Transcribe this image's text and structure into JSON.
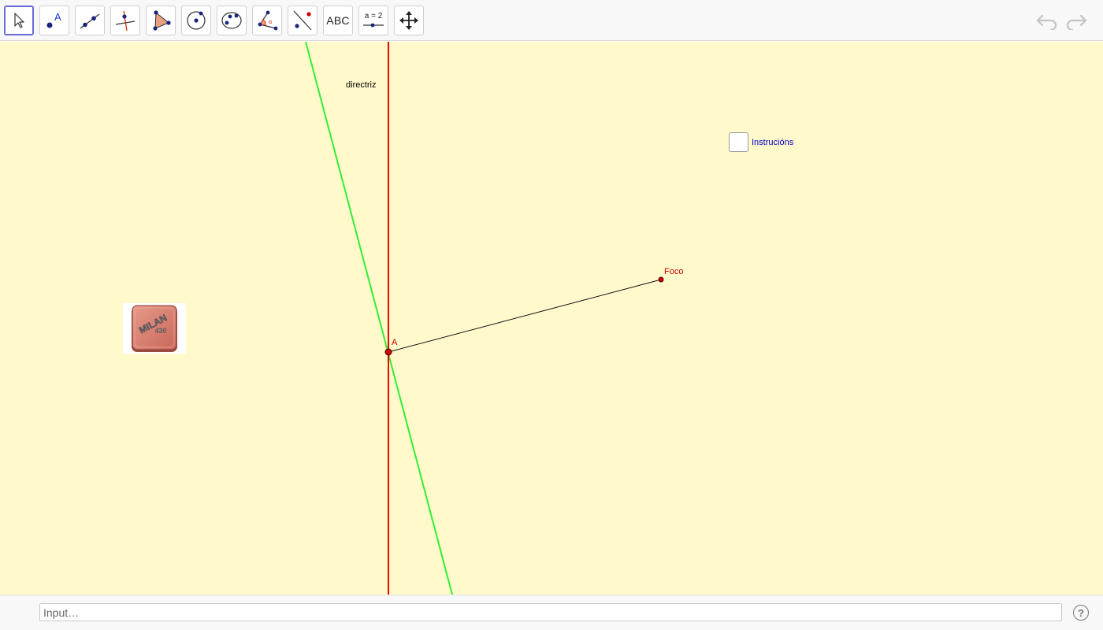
{
  "toolbar": {
    "tools": [
      {
        "name": "move-tool",
        "icon": "cursor-arrow-icon"
      },
      {
        "name": "point-tool",
        "icon": "point-label-icon",
        "text": "A"
      },
      {
        "name": "line-tool",
        "icon": "line-two-points-icon"
      },
      {
        "name": "perpendicular-line-tool",
        "icon": "perpendicular-line-icon"
      },
      {
        "name": "polygon-tool",
        "icon": "polygon-icon"
      },
      {
        "name": "circle-tool",
        "icon": "circle-center-point-icon"
      },
      {
        "name": "ellipse-tool",
        "icon": "ellipse-icon"
      },
      {
        "name": "angle-tool",
        "icon": "angle-icon"
      },
      {
        "name": "reflect-tool",
        "icon": "reflect-about-line-icon"
      },
      {
        "name": "text-tool",
        "icon": "text-icon",
        "text": "ABC"
      },
      {
        "name": "slider-tool",
        "icon": "slider-icon",
        "text": "a = 2"
      },
      {
        "name": "move-graphics-view-tool",
        "icon": "move-arrows-icon"
      }
    ],
    "undo_icon": "undo-icon",
    "redo_icon": "redo-icon"
  },
  "canvas": {
    "background": "#fff9cc",
    "directrix_label": "directriz",
    "directrix_color": "#ee0000",
    "tangent_color": "#33ee33",
    "point_a_label": "A",
    "focus_label": "Foco",
    "point_color": "#cc0000",
    "checkbox_label": "Instrucións",
    "checkbox_label_color": "#0000cc",
    "checkbox_checked": false,
    "eraser": {
      "icon": "eraser-image-icon",
      "brand": "MILAN",
      "model": "430"
    }
  },
  "input_bar": {
    "placeholder": "Input…",
    "value": "",
    "help_label": "?"
  }
}
